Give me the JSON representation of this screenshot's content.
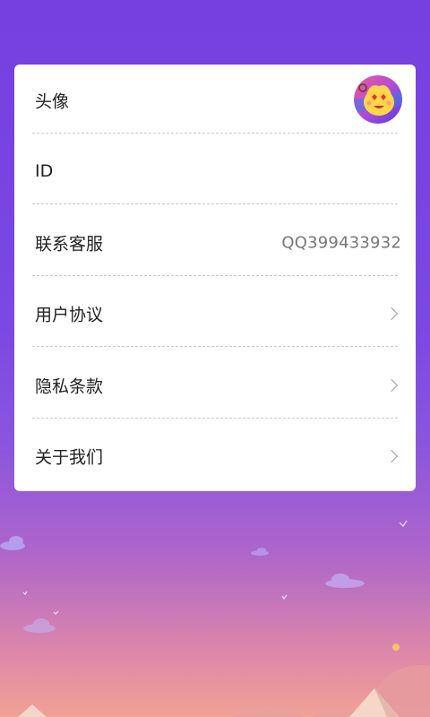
{
  "settings": {
    "items": [
      {
        "label": "头像"
      },
      {
        "label": "ID"
      },
      {
        "label": "联系客服",
        "value": "QQ399433932"
      },
      {
        "label": "用户协议"
      },
      {
        "label": "隐私条款"
      },
      {
        "label": "关于我们"
      }
    ]
  },
  "colors": {
    "background_top": "#7440e0",
    "background_bottom": "#f0a294",
    "card": "#ffffff",
    "label_text": "#222222",
    "value_text": "#777777"
  },
  "icons": [
    "avatar-image",
    "chevron-right-icon"
  ]
}
